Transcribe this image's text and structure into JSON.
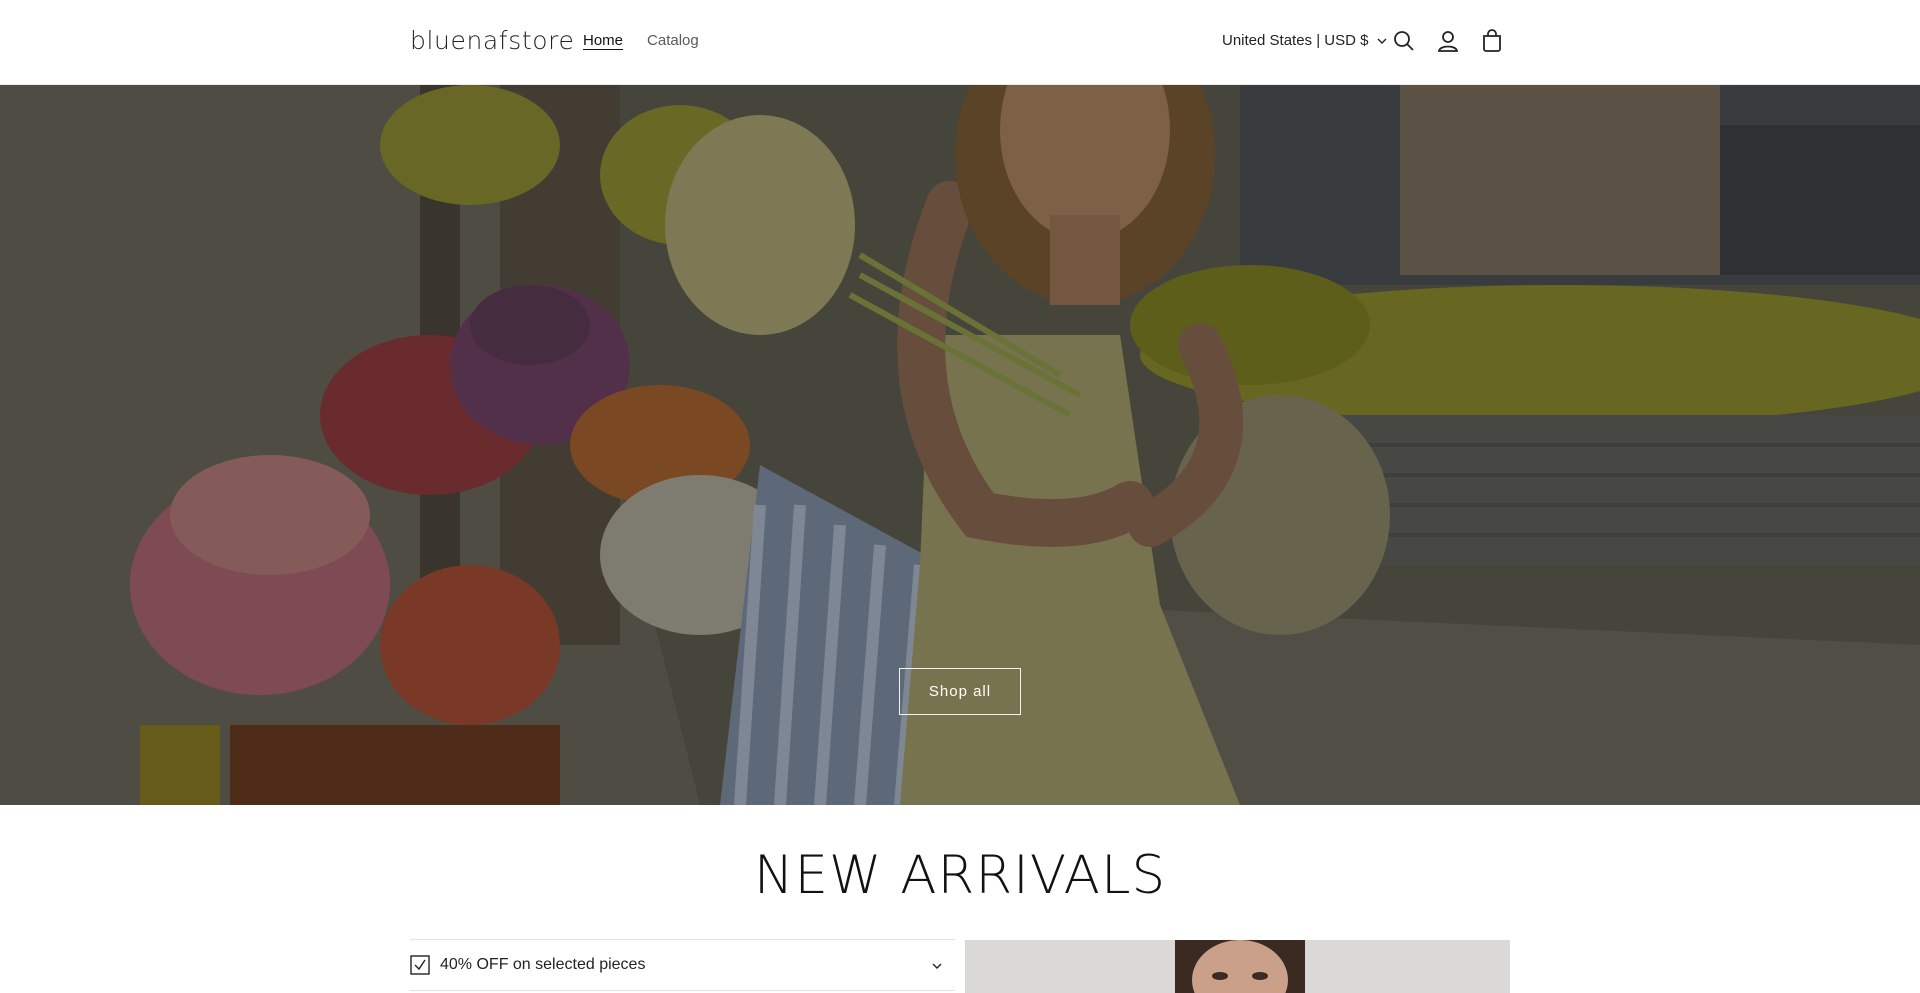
{
  "header": {
    "logo": "bluenafstore",
    "nav": [
      {
        "label": "Home",
        "active": true
      },
      {
        "label": "Catalog",
        "active": false
      }
    ],
    "country_selector": "United States | USD $",
    "icons": [
      "search-icon",
      "account-icon",
      "cart-icon"
    ]
  },
  "hero": {
    "button_label": "Shop all"
  },
  "new_arrivals": {
    "title": "NEW ARRIVALS",
    "accordion_label": "40% OFF on selected pieces"
  },
  "colors": {
    "text": "#121212",
    "border": "#e4e4e4",
    "hero_button_border": "#f2f2f2"
  }
}
